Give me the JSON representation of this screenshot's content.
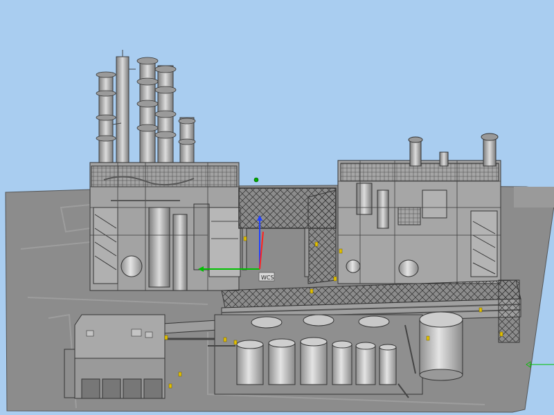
{
  "viewport": {
    "background": "#a9cdf0",
    "ground_color": "#8c8c8c",
    "model_color": "#b4b4b4",
    "edge_color": "#3c3c3c",
    "highlight_color": "#e2c000"
  },
  "coordinate_system": {
    "label": "WCS",
    "x_axis_color": "#00c000",
    "y_axis_color": "#2040ff",
    "z_axis_color": "#ff2020"
  },
  "pivot": {
    "color": "#00aa00",
    "icon": "pivot-point-icon"
  }
}
